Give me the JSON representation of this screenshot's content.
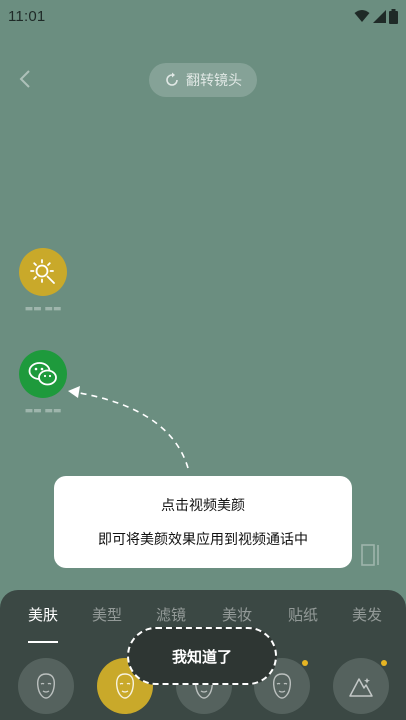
{
  "status_bar": {
    "time": "11:01",
    "icons": [
      "wifi-icon",
      "signal-icon",
      "battery-icon"
    ]
  },
  "top_bar": {
    "back_icon": "chevron-left-icon",
    "flip_label": "翻转镜头",
    "flip_icon": "rotate-icon"
  },
  "side_buttons": [
    {
      "icon": "brightness-icon",
      "color": "#c9a92a"
    },
    {
      "icon": "wechat-icon",
      "color": "#1e9a3c"
    }
  ],
  "tooltip": {
    "title": "点击视频美颜",
    "description": "即可将美颜效果应用到视频通话中"
  },
  "tabs": [
    "美肤",
    "美型",
    "滤镜",
    "美妆",
    "贴纸",
    "美发"
  ],
  "active_tab": "美肤",
  "got_it_label": "我知道了",
  "colors": {
    "background": "#6b8e80",
    "panel": "#3b4844",
    "accent_yellow": "#c9a92a",
    "wechat_green": "#1e9a3c"
  }
}
